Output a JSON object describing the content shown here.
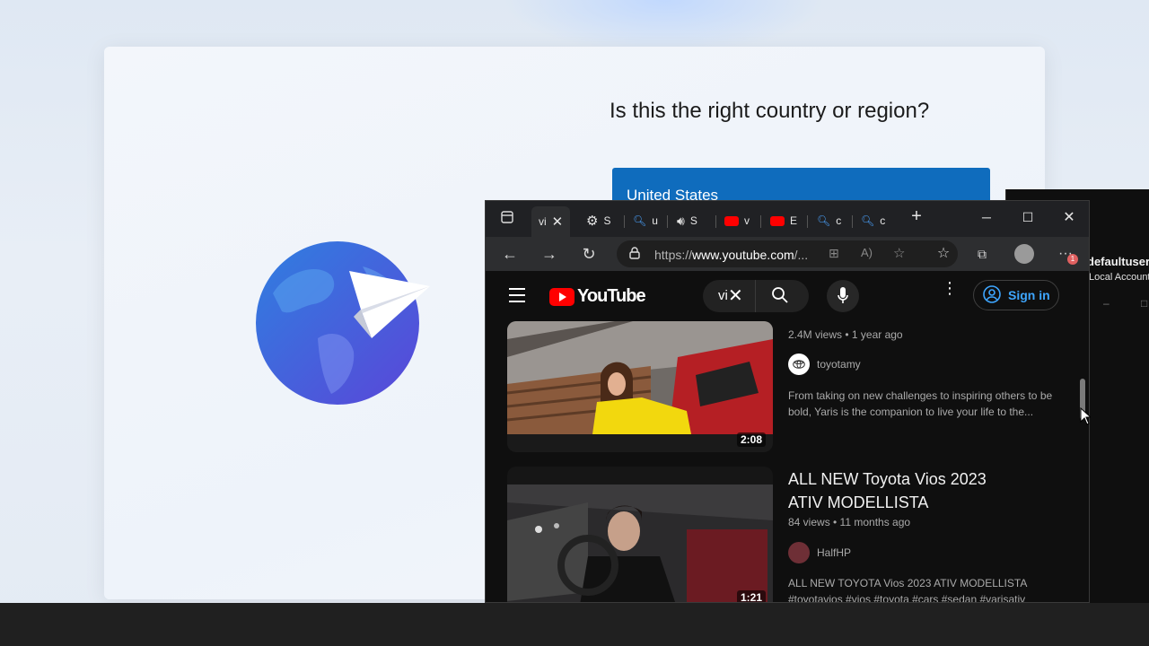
{
  "oobe": {
    "title": "Is this the right country or region?",
    "selected_country": "United States"
  },
  "side_window": {
    "user": "defaultuser",
    "account": "Local Account",
    "minimize": "–",
    "maximize": "□"
  },
  "browser": {
    "tabs": [
      {
        "icon": "youtube-icon",
        "label": "vi"
      },
      {
        "icon": "gear-icon",
        "label": "S"
      },
      {
        "icon": "search-icon",
        "label": "u"
      },
      {
        "icon": "speaker-icon",
        "label": "S"
      },
      {
        "icon": "youtube-icon",
        "label": "v"
      },
      {
        "icon": "youtube-icon",
        "label": "E"
      },
      {
        "icon": "search-icon",
        "label": "c"
      },
      {
        "icon": "search-icon",
        "label": "c"
      }
    ],
    "url_prefix": "https://",
    "url_host": "www.youtube.com",
    "url_suffix": "/...",
    "notification_count": "1"
  },
  "youtube": {
    "logo_text": "YouTube",
    "search_value": "vi",
    "sign_in_label": "Sign in",
    "videos": [
      {
        "views": "2.4M views • 1 year ago",
        "channel": "toyotamy",
        "description": "From taking on new challenges to inspiring others to be bold, Yaris is the companion to live your life to the...",
        "duration": "2:08"
      },
      {
        "title": "ALL NEW Toyota Vios 2023 ATIV MODELLISTA",
        "views": "84 views • 11 months ago",
        "channel": "HalfHP",
        "description": "ALL NEW TOYOTA Vios 2023 ATIV MODELLISTA #toyotavios #vios #toyota #cars #sedan #varisativ",
        "duration": "1:21"
      }
    ]
  },
  "colors": {
    "oobe_accent": "#0f6cbd",
    "youtube_red": "#ff0000",
    "signin_blue": "#3ea6ff"
  }
}
